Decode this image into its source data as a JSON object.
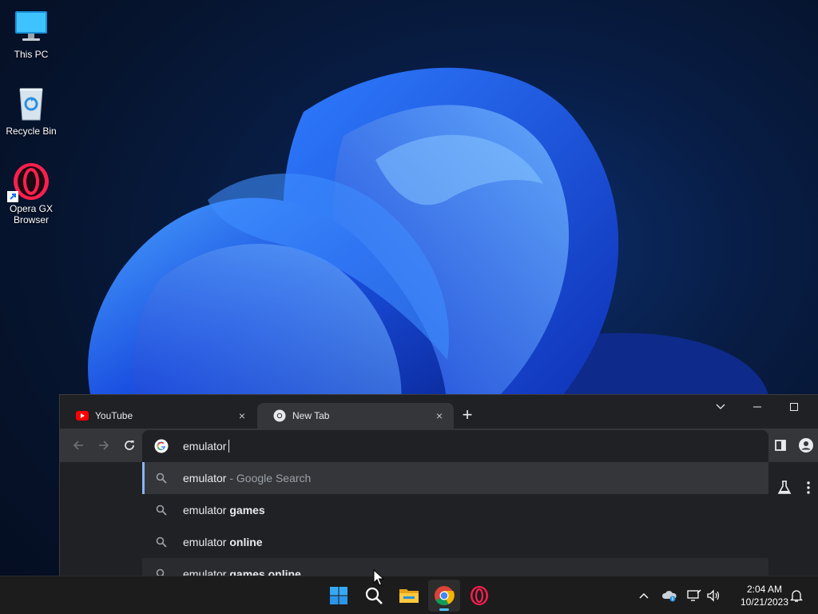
{
  "desktop": {
    "icons": [
      {
        "label": "This PC"
      },
      {
        "label": "Recycle Bin"
      },
      {
        "label": "Opera GX Browser"
      }
    ]
  },
  "browser": {
    "tabs": [
      {
        "title": "YouTube",
        "favicon": "youtube-icon",
        "close": "×"
      },
      {
        "title": "New Tab",
        "favicon": "chrome-icon",
        "close": "×",
        "active": true
      }
    ],
    "new_tab": "+",
    "window_controls": [
      "chevron-down-icon",
      "minimize-icon",
      "maximize-icon"
    ],
    "omnibox": {
      "value": "emulator "
    },
    "suggestions": [
      {
        "query": "emulator",
        "suffix": "",
        "hint": "- Google Search",
        "highlighted": true
      },
      {
        "query": "emulator ",
        "suffix": "games",
        "hint": ""
      },
      {
        "query": "emulator ",
        "suffix": "online",
        "hint": ""
      },
      {
        "query": "emulator ",
        "suffix": "games online",
        "hint": ""
      }
    ]
  },
  "taskbar": {
    "pinned": [
      "windows-start-icon",
      "search-icon",
      "file-explorer-icon",
      "chrome-icon",
      "opera-gx-icon"
    ],
    "clock": {
      "time": "2:04 AM",
      "date": "10/21/2023"
    }
  },
  "colors": {
    "accent_blue": "#8ab4f8",
    "taskbar_indicator": "#4cc2ff",
    "browser_bg": "#202124",
    "toolbar_bg": "#35363a"
  }
}
